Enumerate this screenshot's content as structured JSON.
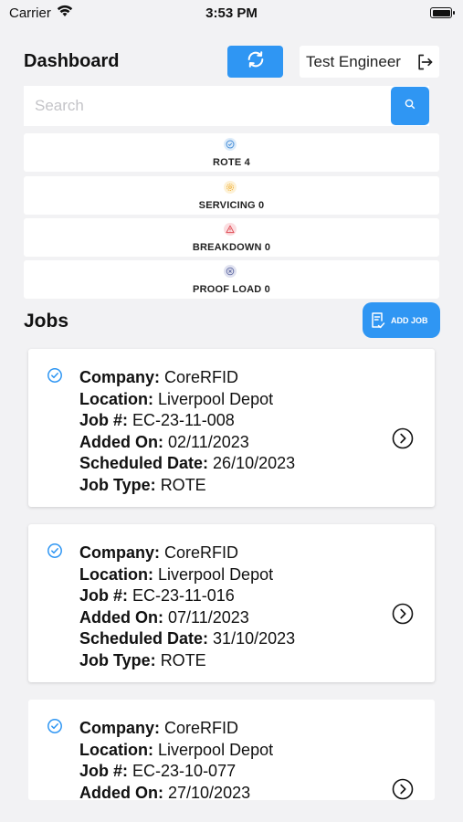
{
  "status_bar": {
    "carrier": "Carrier",
    "time": "3:53 PM"
  },
  "header": {
    "title": "Dashboard",
    "user_name": "Test Engineer"
  },
  "search": {
    "placeholder": "Search",
    "value": ""
  },
  "stats": [
    {
      "label": "ROTE 4",
      "icon": "check-circle-icon",
      "color": "#4a90d9",
      "bg": "#dcebf9"
    },
    {
      "label": "SERVICING 0",
      "icon": "gear-icon",
      "color": "#f2b84b",
      "bg": "#fdf1d6"
    },
    {
      "label": "BREAKDOWN 0",
      "icon": "warning-icon",
      "color": "#e0525a",
      "bg": "#fbdde0"
    },
    {
      "label": "PROOF LOAD 0",
      "icon": "close-circle-icon",
      "color": "#6a73a8",
      "bg": "#e0e2f0"
    }
  ],
  "jobs_section": {
    "title": "Jobs",
    "add_label": "ADD JOB"
  },
  "field_labels": {
    "company": "Company:",
    "location": "Location:",
    "job_no": "Job #:",
    "added_on": "Added On:",
    "scheduled": "Scheduled Date:",
    "job_type": "Job Type:"
  },
  "jobs": [
    {
      "company": "CoreRFID",
      "location": "Liverpool Depot",
      "job_no": "EC-23-11-008",
      "added_on": "02/11/2023",
      "scheduled": "26/10/2023",
      "job_type": "ROTE"
    },
    {
      "company": "CoreRFID",
      "location": "Liverpool Depot",
      "job_no": "EC-23-11-016",
      "added_on": "07/11/2023",
      "scheduled": "31/10/2023",
      "job_type": "ROTE"
    },
    {
      "company": "CoreRFID",
      "location": "Liverpool Depot",
      "job_no": "EC-23-10-077",
      "added_on": "27/10/2023"
    }
  ],
  "colors": {
    "accent": "#2f96f3",
    "background": "#f2f2f4"
  }
}
